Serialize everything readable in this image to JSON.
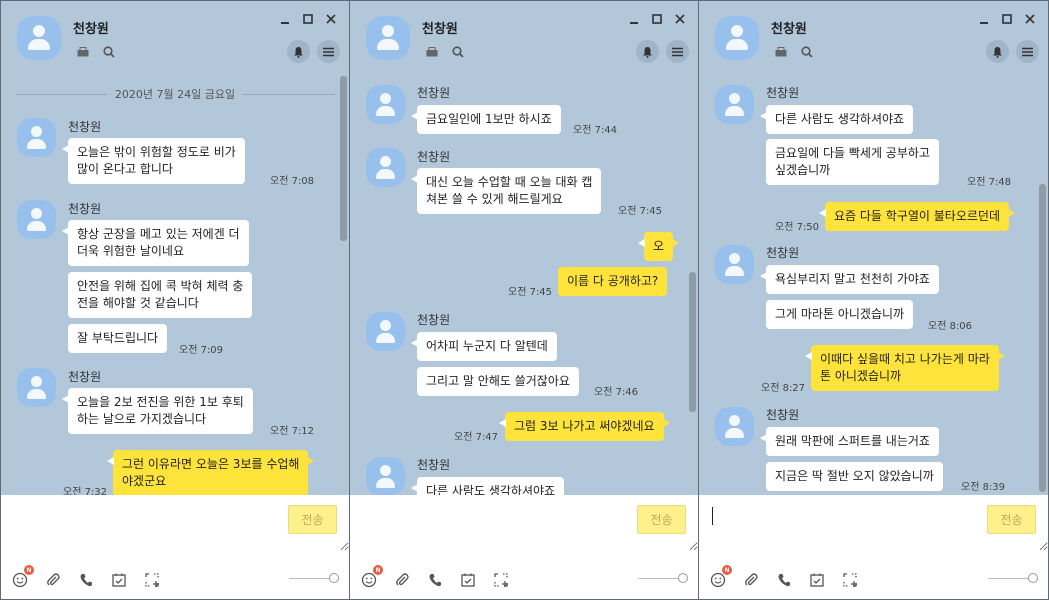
{
  "colors": {
    "chat_bg": "#b2c7d9",
    "my_bubble": "#fee33a",
    "other_bubble": "#ffffff",
    "send_disabled": "#fef08b"
  },
  "contact_name": "천창원",
  "send_label": "전송",
  "badge": "N",
  "icons": {
    "title_small": [
      "drawer-icon",
      "search-icon"
    ],
    "title_round": [
      "bell-icon",
      "menu-icon"
    ],
    "window": [
      "minimize-icon",
      "maximize-icon",
      "close-icon"
    ],
    "toolbar": [
      "emoticon-icon",
      "attach-icon",
      "call-icon",
      "calendar-icon",
      "capture-icon"
    ]
  },
  "window1": {
    "date": "2020년 7월 24일 금요일",
    "messages": [
      {
        "text": "오늘은 밖이 위험할 정도로 비가\n많이 온다고 합니다",
        "time": "오전 7:08"
      },
      {
        "text": "항상 군장을 메고 있는 저에겐 더\n더욱 위험한 날이네요"
      },
      {
        "text": "안전을 위해 집에 콕 박혀 체력 충\n전을 해야할 것 같습니다"
      },
      {
        "text": "잘 부탁드립니다",
        "time": "오전 7:09"
      },
      {
        "text": "오늘을 2보 전진을 위한 1보 후퇴\n하는 날으로 가지겠습니다",
        "time": "오전 7:12"
      },
      {
        "text": "그런 이유라면 오늘은 3보를 수업해\n야겠군요",
        "time": "오전 7:32"
      }
    ]
  },
  "window2": {
    "messages": [
      {
        "text": "금요일인에 1보만 하시죠",
        "time": "오전 7:44"
      },
      {
        "text": "대신 오늘 수업할 때 오늘 대화 캡\n쳐본 쓸 수 있게 해드릴게요",
        "time": "오전 7:45"
      },
      {
        "text": "오"
      },
      {
        "text": "이름 다 공개하고?",
        "time": "오전 7:45"
      },
      {
        "text": "어차피 누군지 다 알텐데"
      },
      {
        "text": "그리고 말 안해도 쓸거잖아요",
        "time": "오전 7:46"
      },
      {
        "text": "그럼 3보 나가고 써야겠네요",
        "time": "오전 7:47"
      },
      {
        "text": "다른 사람도 생각하셔야죠"
      }
    ]
  },
  "window3": {
    "messages": [
      {
        "text": "다른 사람도 생각하셔야죠"
      },
      {
        "text": "금요일에 다들 빡세게 공부하고\n싶겠습니까",
        "time": "오전 7:48"
      },
      {
        "text": "요즘 다들 학구열이 불타오르던데",
        "time": "오전 7:50"
      },
      {
        "text": "욕심부리지 말고 천천히 가야죠"
      },
      {
        "text": "그게 마라톤 아니겠습니까",
        "time": "오전 8:06"
      },
      {
        "text": "이때다 싶을때 치고 나가는게 마라\n톤 아니겠습니까",
        "time": "오전 8:27"
      },
      {
        "text": "원래 막판에 스퍼트를 내는거죠"
      },
      {
        "text": "지금은 딱 절반 오지 않았습니까",
        "time": "오전 8:39"
      }
    ]
  }
}
